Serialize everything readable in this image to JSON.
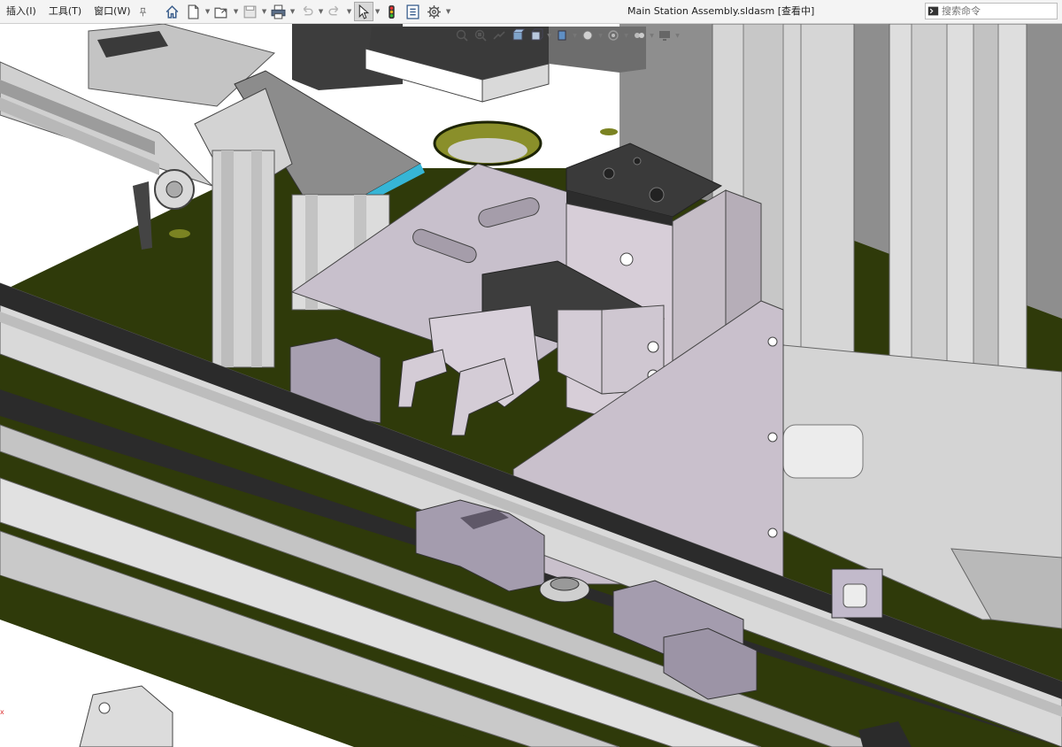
{
  "menubar": {
    "insert": "插入(I)",
    "tools": "工具(T)",
    "window": "窗口(W)"
  },
  "window": {
    "title": "Main Station Assembly.sldasm [查看中]"
  },
  "search": {
    "placeholder": "搜索命令"
  },
  "icons": {
    "pin": "pin-icon",
    "home": "home-icon",
    "new": "new-document-icon",
    "open": "open-folder-icon",
    "save": "save-icon",
    "print": "print-icon",
    "undo": "undo-icon",
    "redo": "redo-icon",
    "select": "select-cursor-icon",
    "rebuild": "traffic-light-icon",
    "file_props": "file-properties-icon",
    "options": "gear-icon",
    "command": "command-prompt-icon"
  },
  "heads_up": {
    "items": [
      "zoom-to-fit-icon",
      "zoom-area-icon",
      "previous-view-icon",
      "section-view-icon",
      "view-orientation-icon",
      "display-style-icon",
      "hide-show-icon",
      "appearance-icon",
      "scene-icon",
      "display-settings-icon"
    ]
  },
  "axis": {
    "label": "x"
  },
  "colors": {
    "plate": "#2f3a0a",
    "aluminum": "#d8d8d8",
    "lavender": "#c9c0cc",
    "dark_part": "#3c3c3c",
    "belt": "#2b2b2b"
  }
}
